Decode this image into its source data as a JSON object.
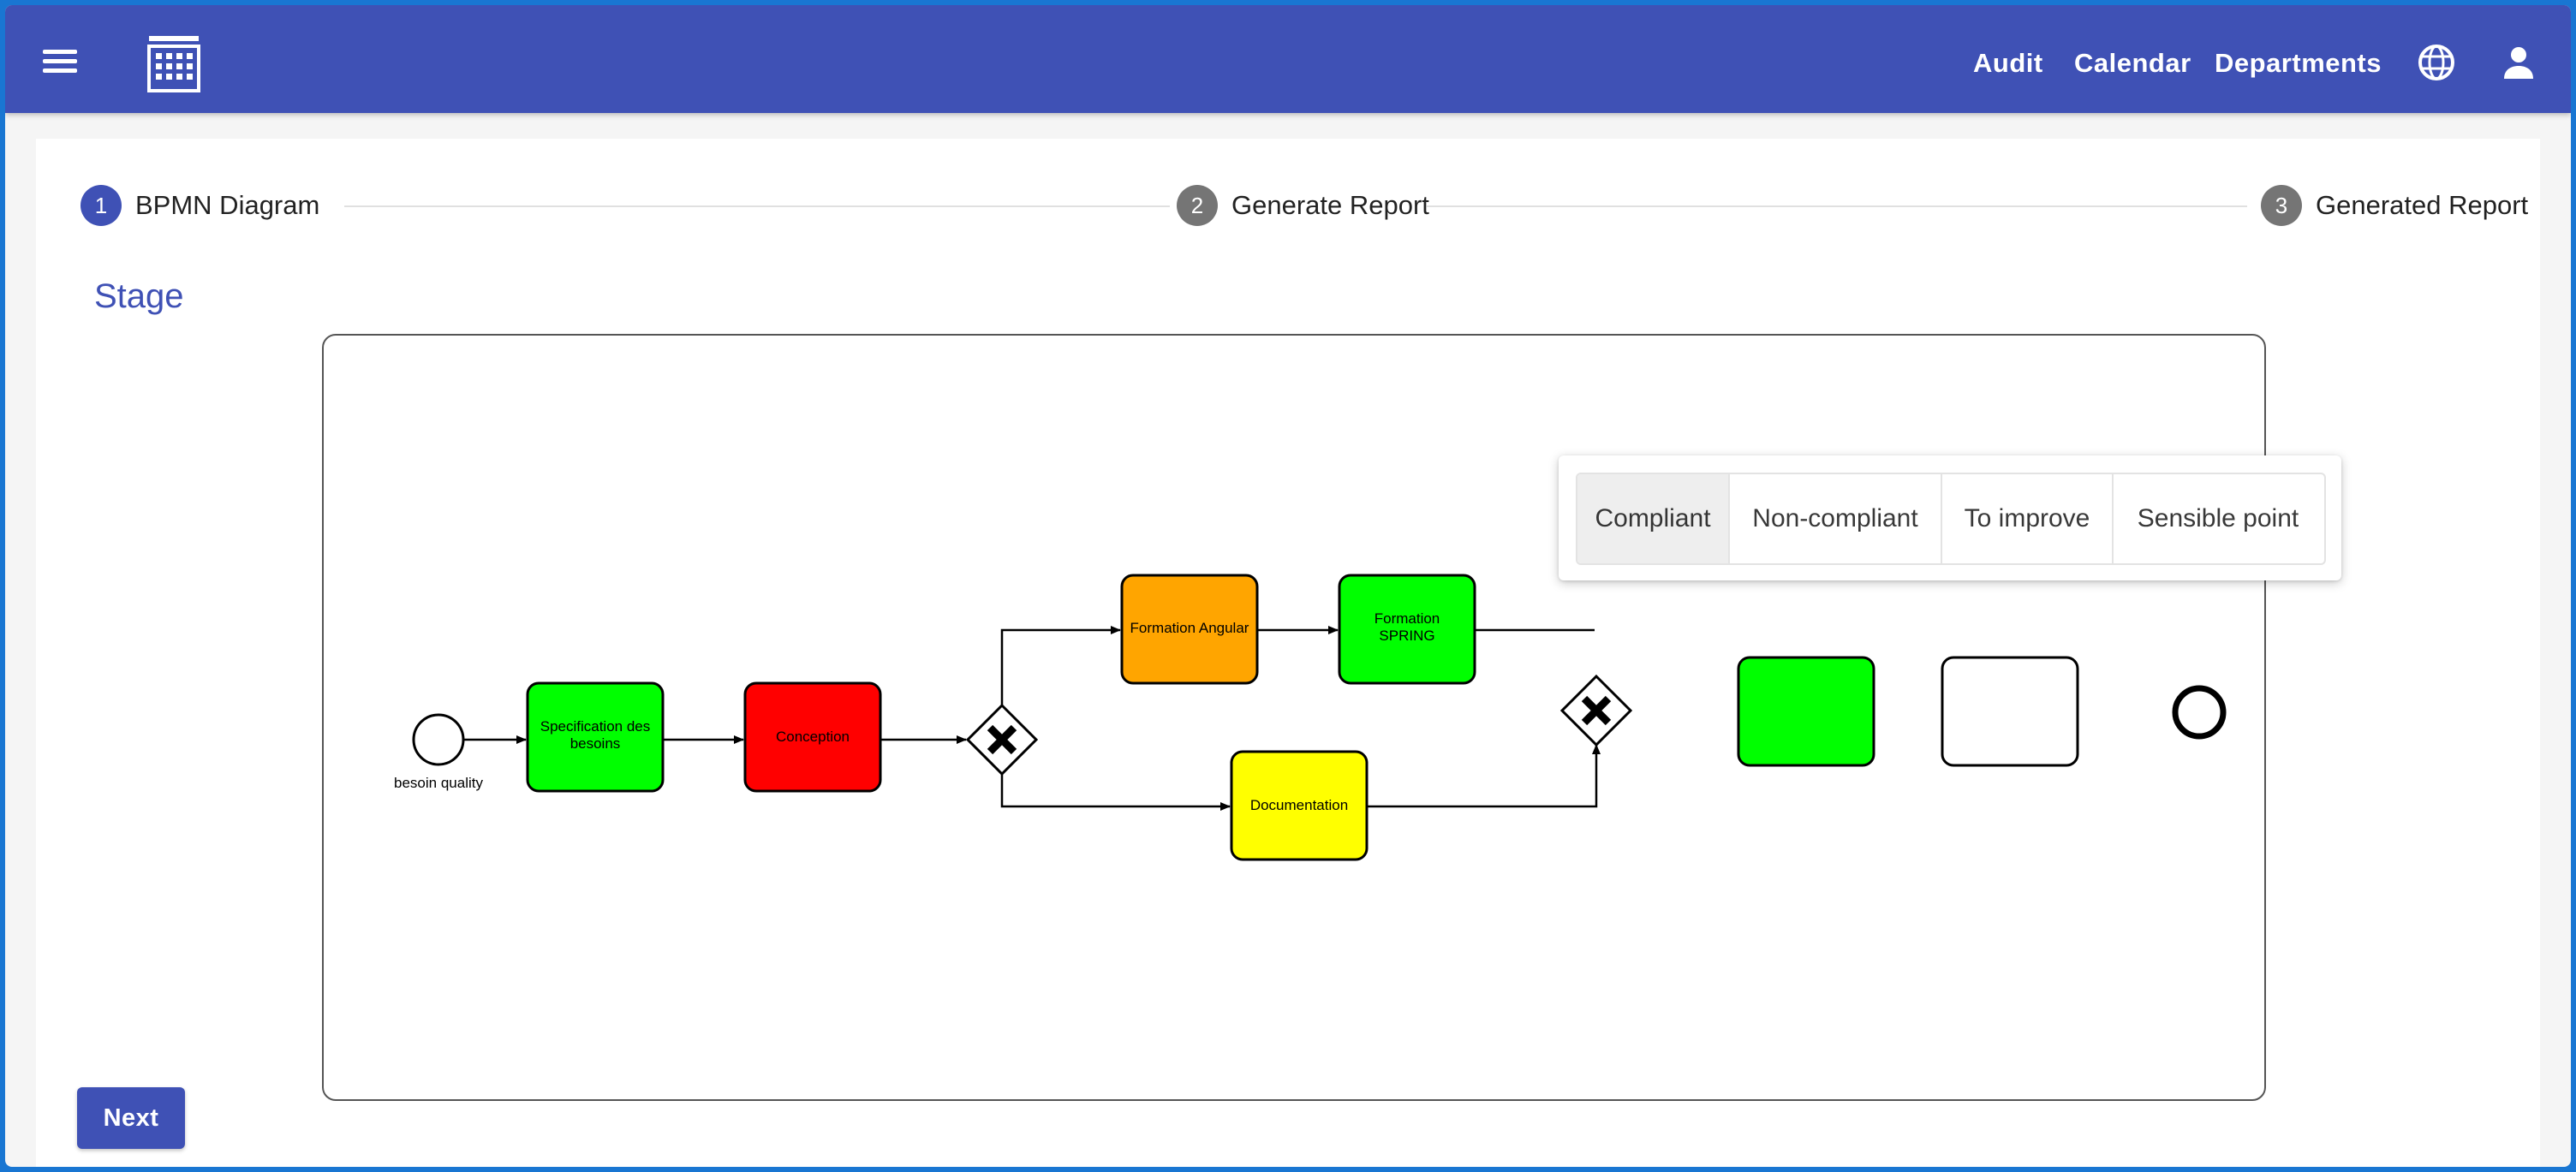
{
  "header": {
    "nav": [
      "Audit",
      "Calendar",
      "Departments"
    ],
    "icons": {
      "menu": "menu-icon",
      "logo": "building-icon",
      "language": "globe-icon",
      "account": "person-icon"
    }
  },
  "stepper": {
    "steps": [
      {
        "number": "1",
        "label": "BPMN Diagram"
      },
      {
        "number": "2",
        "label": "Generate Report"
      },
      {
        "number": "3",
        "label": "Generated Report"
      }
    ],
    "active_color": "#3f51b5",
    "inactive_color": "#757575"
  },
  "stage": {
    "title": "Stage"
  },
  "diagram": {
    "start_event_label": "besoin quality",
    "tasks": {
      "specification": {
        "line1": "Specification des",
        "line2": "besoins",
        "color": "#00ff00"
      },
      "conception": {
        "label": "Conception",
        "color": "#ff0000"
      },
      "formation_angular": {
        "label": "Formation Angular",
        "color": "#ffa500"
      },
      "formation_spring": {
        "line1": "Formation",
        "line2": "SPRING",
        "color": "#00ff00"
      },
      "documentation": {
        "label": "Documentation",
        "color": "#ffff00"
      },
      "hidden_task_1": {
        "color": "#00ff00"
      },
      "hidden_task_2": {
        "color": "#ffffff"
      }
    }
  },
  "status_menu": {
    "options": [
      "Compliant",
      "Non-compliant",
      "To improve",
      "Sensible point"
    ],
    "selected": "Compliant"
  },
  "actions": {
    "next_label": "Next"
  },
  "colors": {
    "primary": "#3f51b5",
    "frame_border": "#1976d2"
  }
}
